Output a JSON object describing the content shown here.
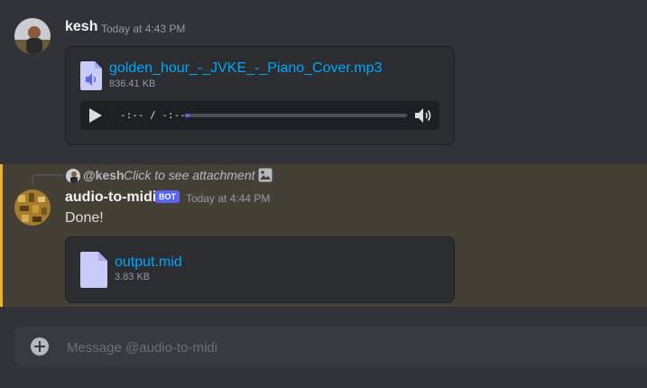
{
  "messages": [
    {
      "username": "kesh",
      "timestamp": "Today at 4:43 PM",
      "attachment": {
        "type": "audio",
        "filename": "golden_hour_-_JVKE_-_Piano_Cover.mp3",
        "size": "836.41 KB",
        "player": {
          "time": "-:-- / -:--",
          "progress": 0.02
        }
      }
    },
    {
      "reply": {
        "username": "@kesh",
        "text": "Click to see attachment"
      },
      "username": "audio-to-midi",
      "badge": "BOT",
      "timestamp": "Today at 4:44 PM",
      "body": "Done!",
      "attachment": {
        "type": "file",
        "filename": "output.mid",
        "size": "3.83 KB"
      }
    }
  ],
  "composer": {
    "placeholder": "Message @audio-to-midi"
  },
  "colors": {
    "link": "#00a8fc",
    "mention_bar": "#f0b132",
    "bot_badge": "#5865f2",
    "background": "#313338"
  }
}
